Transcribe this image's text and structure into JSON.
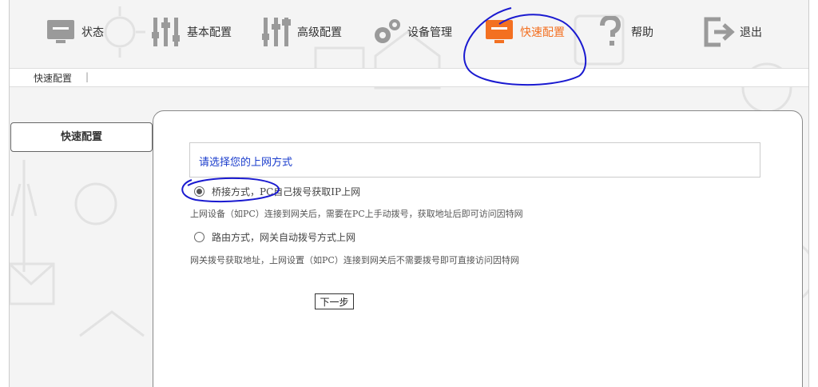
{
  "nav": {
    "items": [
      {
        "label": "状态",
        "icon": "monitor-icon"
      },
      {
        "label": "基本配置",
        "icon": "sliders-icon"
      },
      {
        "label": "高级配置",
        "icon": "advanced-sliders-icon"
      },
      {
        "label": "设备管理",
        "icon": "gears-icon"
      },
      {
        "label": "快速配置",
        "icon": "monitor-icon",
        "active": true
      },
      {
        "label": "帮助",
        "icon": "question-icon"
      },
      {
        "label": "退出",
        "icon": "exit-icon"
      }
    ],
    "active_color": "#f37021",
    "icon_color": "#999999"
  },
  "breadcrumb": {
    "current": "快速配置",
    "separator": "|"
  },
  "sidebar": {
    "items": [
      {
        "label": "快速配置"
      }
    ]
  },
  "main": {
    "section_title": "请选择您的上网方式",
    "options": [
      {
        "label": "桥接方式，PC自己拨号获取IP上网",
        "checked": true,
        "description": "上网设备（如PC）连接到网关后，需要在PC上手动拨号，获取地址后即可访问因特网"
      },
      {
        "label": "路由方式，网关自动拨号方式上网",
        "checked": false,
        "description": "网关拨号获取地址，上网设置（如PC）连接到网关后不需要拨号即可直接访问因特网"
      }
    ],
    "next_label": "下一步"
  },
  "annotation_color": "#1a1ad0"
}
